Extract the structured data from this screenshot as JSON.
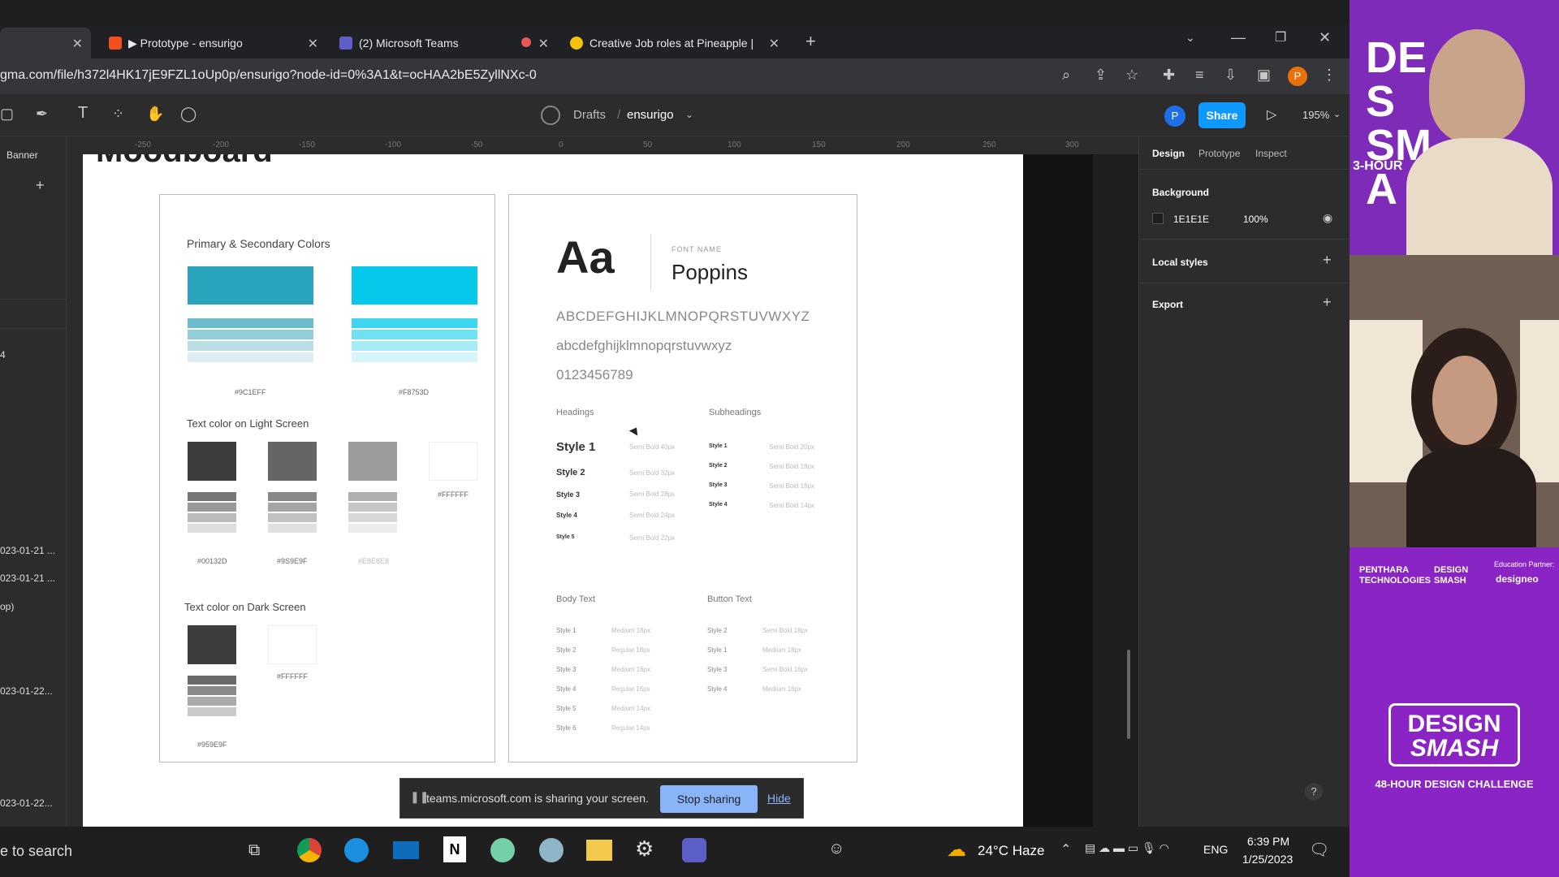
{
  "browser": {
    "tabs": [
      {
        "title": "▶ Prototype - ensurigo"
      },
      {
        "title": "(2) Microsoft Teams"
      },
      {
        "title": "Creative Job roles at Pineapple |"
      }
    ],
    "url": "gma.com/file/h372l4HK17jE9FZL1oUp0p/ensurigo?node-id=0%3A1&t=ocHAA2bE5ZyllNXc-0",
    "profile_initial": "P"
  },
  "figma": {
    "breadcrumb_drafts": "Drafts",
    "breadcrumb_sep": "/",
    "file_name": "ensurigo",
    "avatar": "P",
    "share_label": "Share",
    "zoom": "195%",
    "page_label": "Banner",
    "layers": [
      "4",
      "023-01-21 ...",
      "023-01-21 ...",
      "op)",
      "023-01-22...",
      "023-01-22..."
    ],
    "ruler_ticks": [
      "-250",
      "-200",
      "-150",
      "-100",
      "-50",
      "0",
      "50",
      "100",
      "150",
      "200",
      "250",
      "300"
    ],
    "heading_partial": "Moodboard",
    "right_tabs": [
      "Design",
      "Prototype",
      "Inspect"
    ],
    "background_title": "Background",
    "bg_hex": "1E1E1E",
    "bg_opacity": "100%",
    "local_styles": "Local styles",
    "export": "Export",
    "help": "?"
  },
  "colors_card": {
    "primary_title": "Primary & Secondary Colors",
    "primary_hex": "#9C1EFF",
    "secondary_hex": "#F8753D",
    "primary_color": "#2aa4bd",
    "secondary_color": "#05c8ea",
    "light_title": "Text color on Light Screen",
    "light_hex": [
      "#00132D",
      "#9S9E9F",
      "#E8E8E8",
      "#FFFFFF"
    ],
    "dark_title": "Text color on Dark Screen",
    "dark_hex": [
      "#959E9F",
      "#FFFFFF"
    ]
  },
  "type_card": {
    "aa": "Aa",
    "font_name_label": "FONT NAME",
    "font_name": "Poppins",
    "upper": "ABCDEFGHIJKLMNOPQRSTUVWXYZ",
    "lower": "abcdefghijklmnopqrstuvwxyz",
    "digits": "0123456789",
    "headings_label": "Headings",
    "subheadings_label": "Subheadings",
    "headings": [
      {
        "name": "Style 1",
        "spec": "Semi Bold 40px"
      },
      {
        "name": "Style 2",
        "spec": "Semi Bold 32px"
      },
      {
        "name": "Style 3",
        "spec": "Semi Bold 28px"
      },
      {
        "name": "Style 4",
        "spec": "Semi Bold 24px"
      },
      {
        "name": "Style 5",
        "spec": "Semi Bold 22px"
      }
    ],
    "subheadings": [
      {
        "name": "Style 1",
        "spec": "Semi Bold 20px"
      },
      {
        "name": "Style 2",
        "spec": "Semi Bold 18px"
      },
      {
        "name": "Style 3",
        "spec": "Semi Bold 16px"
      },
      {
        "name": "Style 4",
        "spec": "Semi Bold 14px"
      }
    ],
    "body_label": "Body Text",
    "button_label": "Button Text",
    "body": [
      {
        "name": "Style 1",
        "spec": "Medium 18px"
      },
      {
        "name": "Style 2",
        "spec": "Regular 18px"
      },
      {
        "name": "Style 3",
        "spec": "Medium 16px"
      },
      {
        "name": "Style 4",
        "spec": "Regular 16px"
      },
      {
        "name": "Style 5",
        "spec": "Medium 14px"
      },
      {
        "name": "Style 6",
        "spec": "Regular 14px"
      }
    ],
    "buttons": [
      {
        "name": "Style 2",
        "spec": "Semi Bold 18px"
      },
      {
        "name": "Style 1",
        "spec": "Medium 18px"
      },
      {
        "name": "Style 3",
        "spec": "Semi Bold 16px"
      },
      {
        "name": "Style 4",
        "spec": "Medium 16px"
      }
    ]
  },
  "sharing": {
    "message": "teams.microsoft.com is sharing your screen.",
    "stop": "Stop sharing",
    "hide": "Hide"
  },
  "taskbar": {
    "search": "e to search",
    "weather": "24°C  Haze",
    "lang": "ENG",
    "time": "6:39 PM",
    "date": "1/25/2023"
  },
  "webcam": {
    "sponsor": "PENTHARA TECHNOLOGIES",
    "brand_small": "DESIGN SMASH",
    "education_partner": "Education Partner:",
    "partner": "designeo",
    "logo_line1": "DESIGN",
    "logo_line2": "SMASH",
    "tagline": "48-HOUR DESIGN CHALLENGE",
    "banner_top": "DES SMA",
    "banner_sub": "3-HOUR"
  }
}
